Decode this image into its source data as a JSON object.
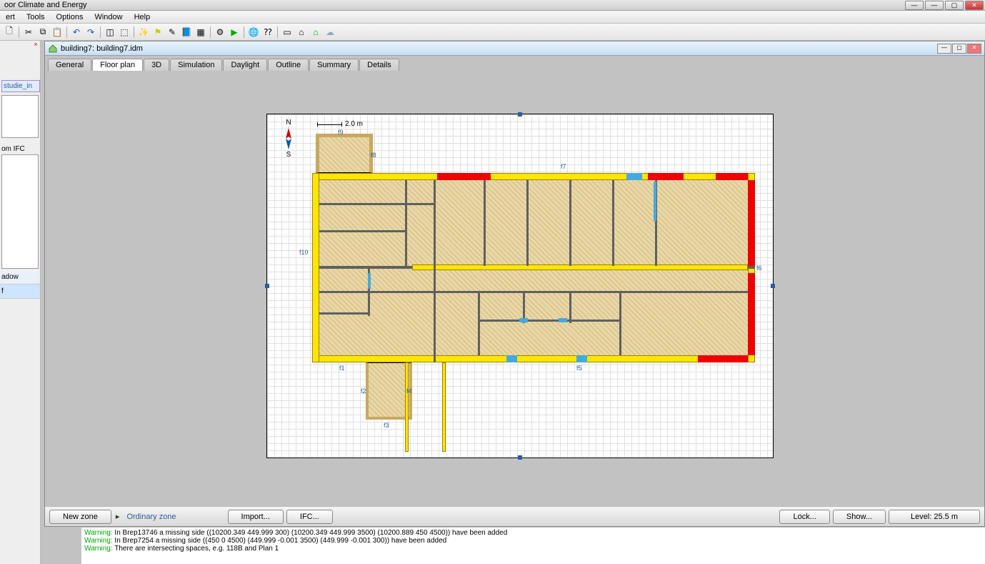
{
  "app_title": "oor Climate and Energy",
  "menu": [
    "ert",
    "Tools",
    "Options",
    "Window",
    "Help"
  ],
  "toolbar_icons": [
    "new",
    "cut",
    "copy",
    "paste",
    "undo",
    "redo",
    "layout-a",
    "layout-b",
    "wizard",
    "marker",
    "note",
    "book",
    "book2",
    "table",
    "run",
    "globe",
    "help-cursor",
    "rect",
    "house-sun",
    "house",
    "cloud"
  ],
  "sidebar": {
    "item_studie": "studie_in",
    "ifc_label": "om IFC",
    "row_adow": "adow",
    "row_f": "f"
  },
  "doc": {
    "title": "building7: building7.idm",
    "tabs": [
      "General",
      "Floor plan",
      "3D",
      "Simulation",
      "Daylight",
      "Outline",
      "Summary",
      "Details"
    ],
    "active_tab": "Floor plan"
  },
  "canvas": {
    "compass_n": "N",
    "compass_s": "S",
    "scale_label": "2.0 m",
    "facades": {
      "f1": "f1",
      "f2": "f2",
      "f3": "f3",
      "f4": "f4",
      "f5": "f5",
      "f6": "f6",
      "f7": "f7",
      "f8": "f8",
      "f9": "f9",
      "f10": "f10"
    }
  },
  "bottom_bar": {
    "new_zone": "New zone",
    "ordinary_zone": "Ordinary zone",
    "import": "Import...",
    "ifc": "IFC...",
    "lock": "Lock...",
    "show": "Show...",
    "level": "Level: 25.5 m"
  },
  "log": [
    {
      "prefix": "Warning:",
      "text": " In Brep13746 a missing side ((10200.349 449.999 300) (10200.349 449.999 3500) (10200.889 450 4500)) have been added"
    },
    {
      "prefix": "Warning:",
      "text": " In Brep7254 a missing side ((450 0 4500) (449.999 -0.001 3500) (449.999 -0.001 300)) have been added"
    },
    {
      "prefix": "Warning:",
      "text": " There are intersecting spaces, e.g. 118B and Plan 1"
    }
  ]
}
